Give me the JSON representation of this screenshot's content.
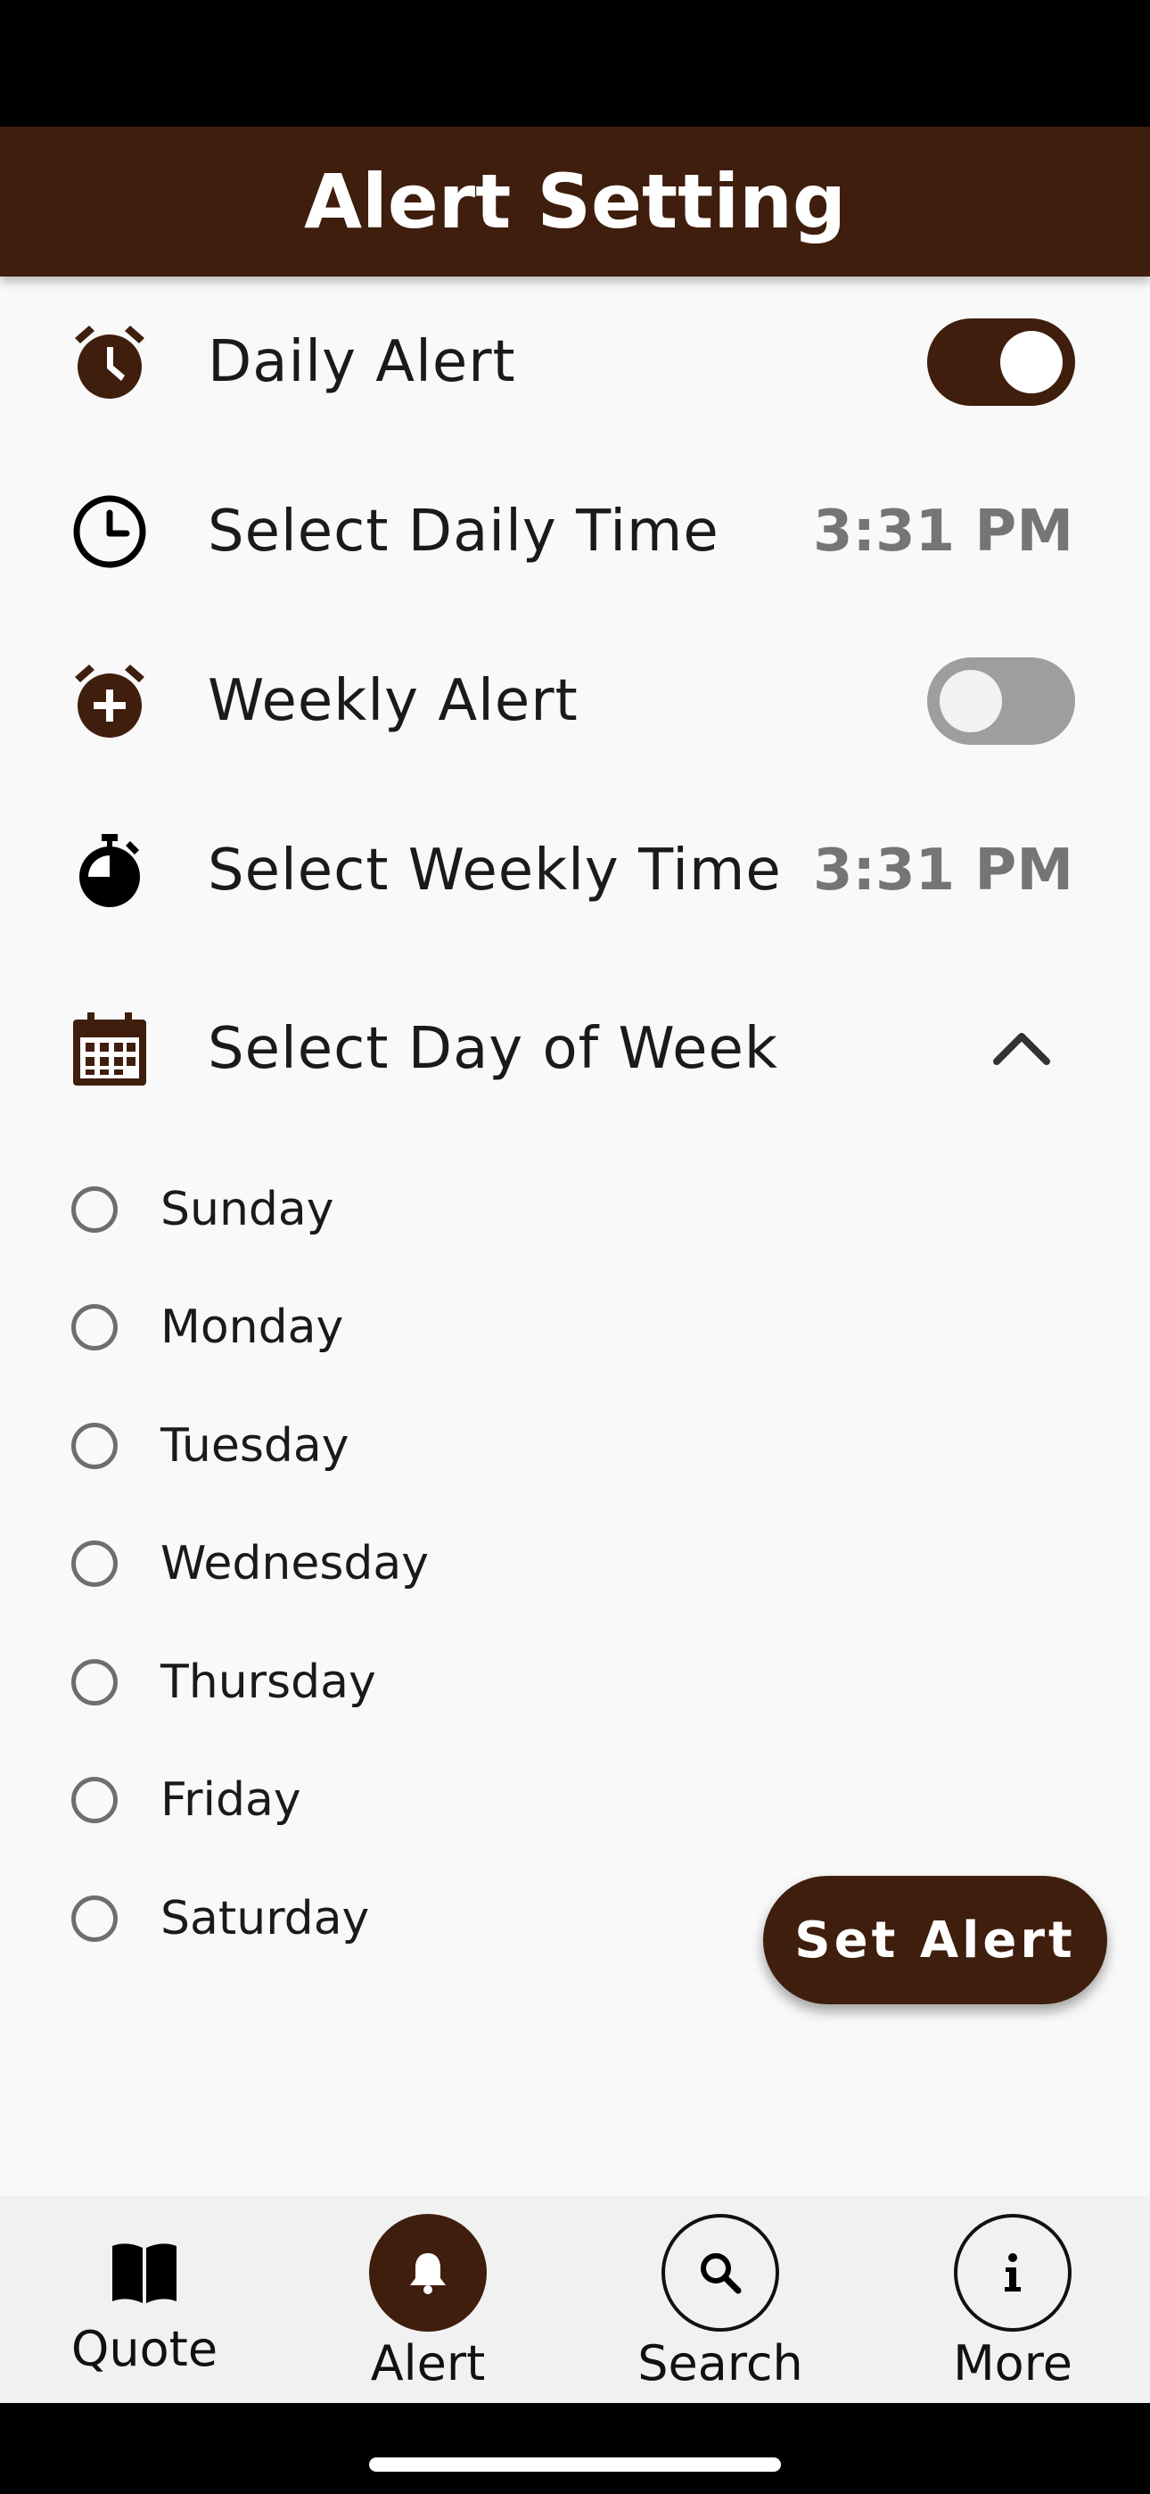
{
  "app_bar": {
    "title": "Alert Setting"
  },
  "settings": {
    "daily_alert": {
      "label": "Daily Alert",
      "enabled": true,
      "icon": "alarm-clock-icon"
    },
    "daily_time": {
      "label": "Select Daily Time",
      "value": "3:31 PM",
      "icon": "clock-icon"
    },
    "weekly_alert": {
      "label": "Weekly Alert",
      "enabled": false,
      "icon": "alarm-add-icon"
    },
    "weekly_time": {
      "label": "Select Weekly Time",
      "value": "3:31 PM",
      "icon": "stopwatch-icon"
    },
    "day_of_week": {
      "label": "Select Day of Week",
      "expanded": true,
      "icon": "calendar-icon"
    }
  },
  "days": [
    "Sunday",
    "Monday",
    "Tuesday",
    "Wednesday",
    "Thursday",
    "Friday",
    "Saturday"
  ],
  "fab": {
    "label": "Set Alert"
  },
  "bottom_nav": {
    "items": [
      {
        "label": "Quote",
        "icon": "book-icon"
      },
      {
        "label": "Alert",
        "icon": "bell-icon",
        "active": true
      },
      {
        "label": "Search",
        "icon": "search-icon"
      },
      {
        "label": "More",
        "icon": "info-icon"
      }
    ]
  },
  "colors": {
    "primary": "#3f1e0d",
    "toggle_off": "#9e9e9e",
    "time_value": "#757575",
    "background": "#f9f9f9"
  }
}
